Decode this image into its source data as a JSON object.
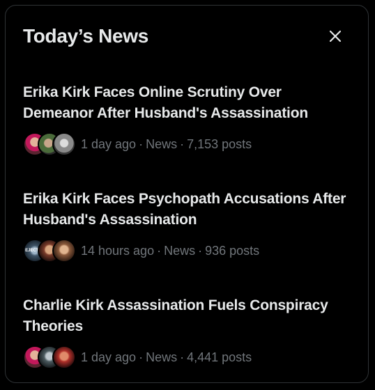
{
  "panel": {
    "title": "Today’s News",
    "close_icon": "close-icon"
  },
  "stories": [
    {
      "headline": "Erika Kirk Faces Online Scrutiny Over Demeanor After Husband's Assassination",
      "time": "1 day ago",
      "category": "News",
      "posts": "7,153 posts"
    },
    {
      "headline": "Erika Kirk Faces Psychopath Accusations After Husband's Assassination",
      "time": "14 hours ago",
      "category": "News",
      "posts": "936 posts",
      "avatar_label": "EJECTED"
    },
    {
      "headline": "Charlie Kirk Assassination Fuels Conspiracy Theories",
      "time": "1 day ago",
      "category": "News",
      "posts": "4,441 posts"
    }
  ],
  "colors": {
    "background": "#000000",
    "border": "#2f3336",
    "text_primary": "#e7e9ea",
    "text_secondary": "#71767b"
  }
}
